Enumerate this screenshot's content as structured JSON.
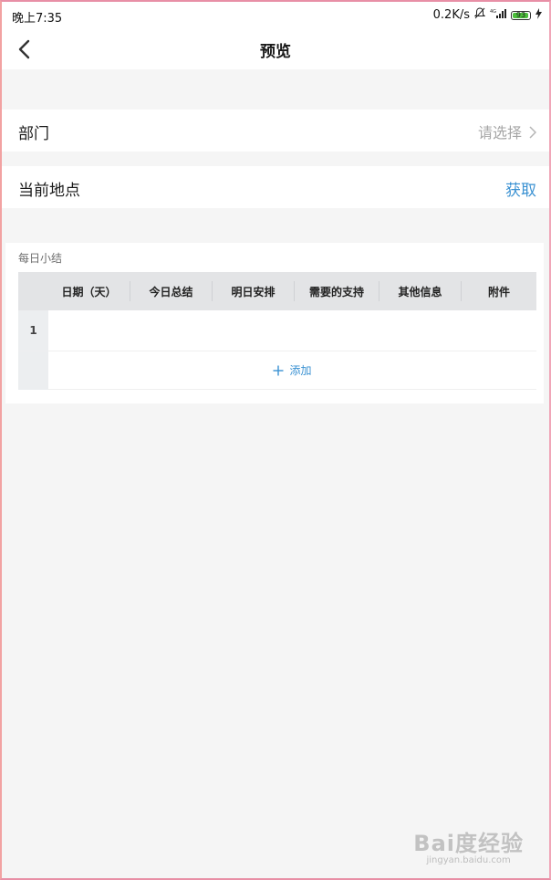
{
  "status_bar": {
    "time": "晚上7:35",
    "network_speed": "0.2K/s",
    "signal_label": "4G",
    "battery_level": "93",
    "battery_fraction": 0.93
  },
  "header": {
    "title": "预览"
  },
  "form": {
    "department": {
      "label": "部门",
      "placeholder": "请选择"
    },
    "location": {
      "label": "当前地点",
      "action": "获取"
    }
  },
  "daily_summary": {
    "title": "每日小结",
    "columns": [
      "日期（天）",
      "今日总结",
      "明日安排",
      "需要的支持",
      "其他信息",
      "附件"
    ],
    "rows": [
      {
        "index": "1"
      }
    ],
    "add_label": "添加"
  },
  "watermark": {
    "logo": "Bai度经验",
    "url": "jingyan.baidu.com"
  },
  "colors": {
    "accent": "#3a91d2",
    "background": "#f5f5f5",
    "header_bg": "#e3e4e6",
    "battery": "#4bbf3a"
  }
}
